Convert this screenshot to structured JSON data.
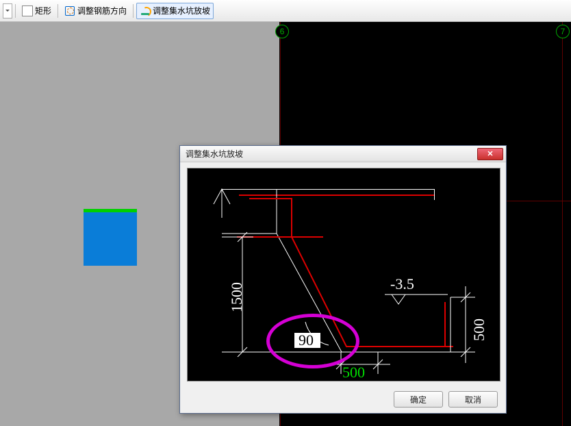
{
  "toolbar": {
    "rectangle_label": "矩形",
    "rebar_dir_label": "调整钢筋方向",
    "slope_label": "调整集水坑放坡"
  },
  "axes": {
    "marker_6": "6",
    "marker_7": "7"
  },
  "dialog": {
    "title": "调整集水坑放坡",
    "ok_label": "确定",
    "cancel_label": "取消"
  },
  "diagram": {
    "depth": "1500",
    "bottom_width": "500",
    "thickness": "500",
    "elevation": "-3.5",
    "angle_input": "90"
  }
}
